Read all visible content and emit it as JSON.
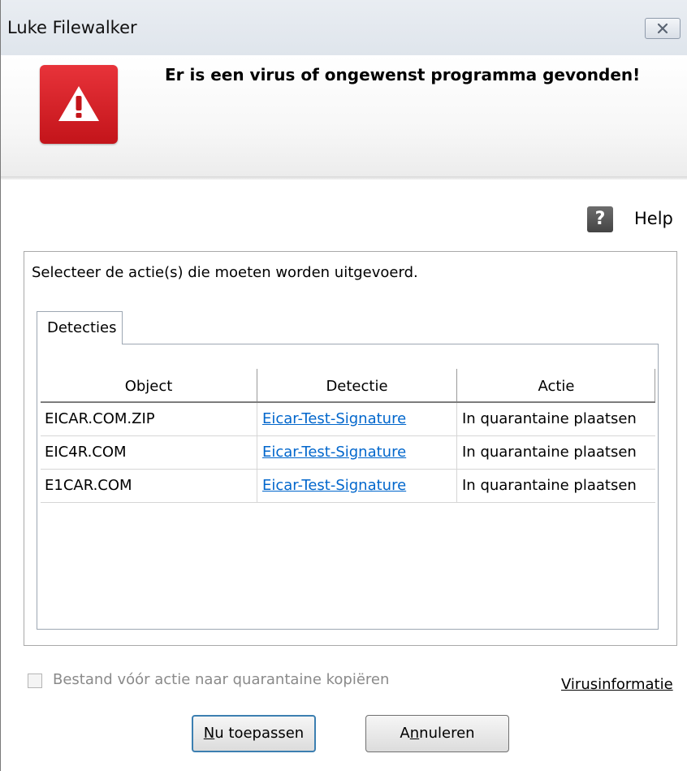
{
  "window": {
    "title": "Luke Filewalker",
    "close_glyph": "✕"
  },
  "header": {
    "title": "Er is een virus of ongewenst programma gevonden!",
    "icon": "warning-icon",
    "accent_color": "#d9232a"
  },
  "help": {
    "icon_glyph": "?",
    "label": "Help"
  },
  "instruction": "Selecteer de actie(s) die moeten worden uitgevoerd.",
  "tabs": [
    {
      "label": "Detecties",
      "selected": true
    }
  ],
  "table": {
    "columns": [
      "Object",
      "Detectie",
      "Actie"
    ],
    "rows": [
      {
        "object": "EICAR.COM.ZIP",
        "detection": "Eicar-Test-Signature",
        "action": "In quarantaine plaatsen"
      },
      {
        "object": "EIC4R.COM",
        "detection": "Eicar-Test-Signature",
        "action": "In quarantaine plaatsen"
      },
      {
        "object": "E1CAR.COM",
        "detection": "Eicar-Test-Signature",
        "action": "In quarantaine plaatsen"
      }
    ]
  },
  "checkbox": {
    "label": "Bestand vóór actie naar quarantaine kopiëren",
    "checked": false,
    "disabled": true
  },
  "links": {
    "virusinfo": "Virusinformatie"
  },
  "buttons": {
    "apply_mnemonic": "N",
    "apply_rest": "u toepassen",
    "cancel_prefix": "A",
    "cancel_mnemonic": "n",
    "cancel_rest": "nuleren"
  },
  "colors": {
    "link": "#0066cc",
    "disabled_text": "#8a8a8a"
  }
}
